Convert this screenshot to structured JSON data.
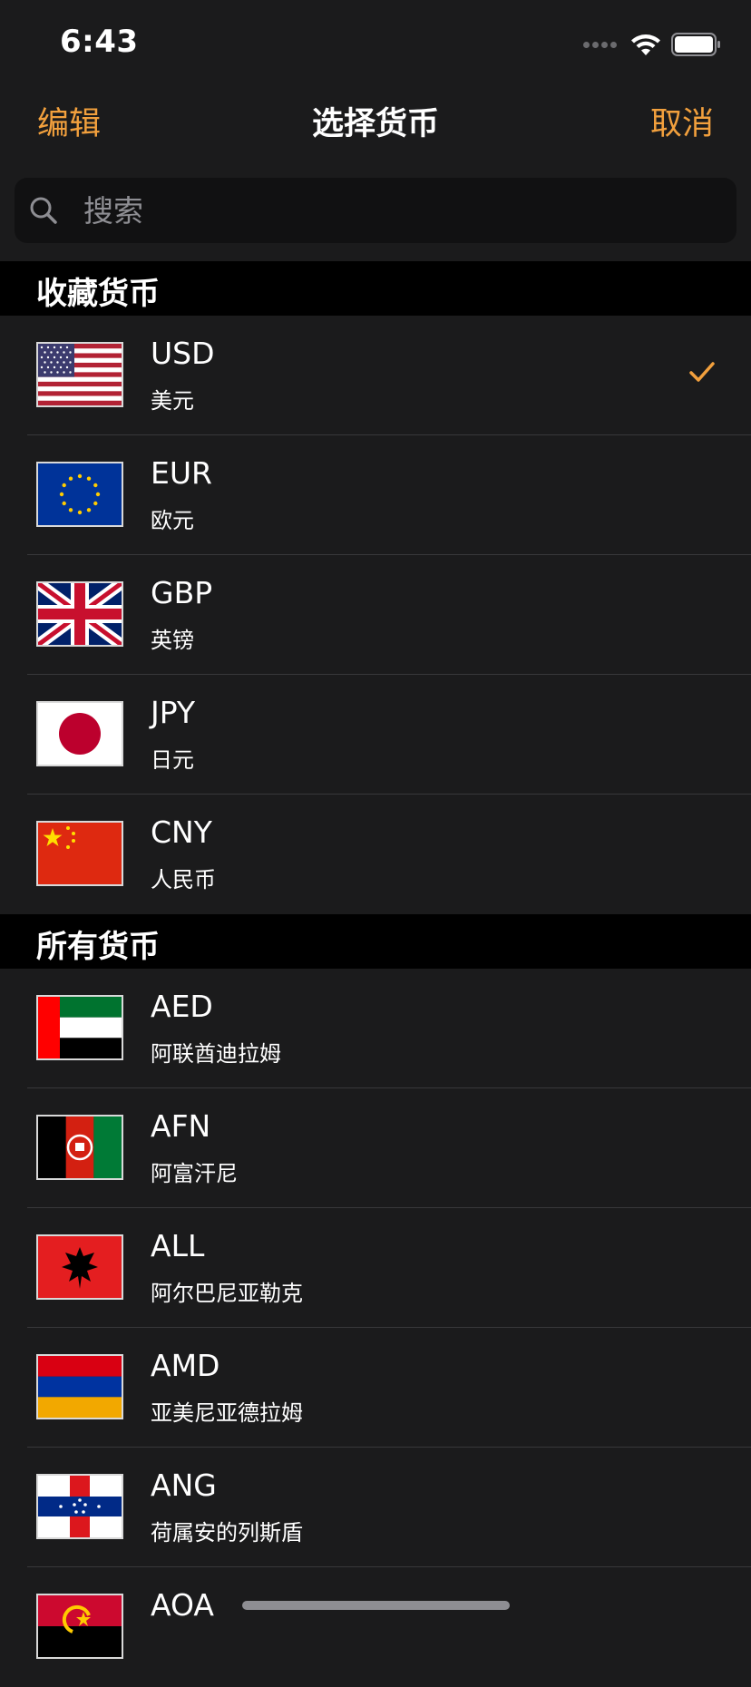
{
  "status_bar": {
    "time": "6:43"
  },
  "nav": {
    "edit_label": "编辑",
    "title": "选择货币",
    "cancel_label": "取消"
  },
  "search": {
    "placeholder": "搜索"
  },
  "sections": [
    {
      "title": "收藏货币",
      "items": [
        {
          "code": "USD",
          "name": "美元",
          "flag": "us-flag",
          "selected": true
        },
        {
          "code": "EUR",
          "name": "欧元",
          "flag": "eu-flag",
          "selected": false
        },
        {
          "code": "GBP",
          "name": "英镑",
          "flag": "gb-flag",
          "selected": false
        },
        {
          "code": "JPY",
          "name": "日元",
          "flag": "jp-flag",
          "selected": false
        },
        {
          "code": "CNY",
          "name": "人民币",
          "flag": "cn-flag",
          "selected": false
        }
      ]
    },
    {
      "title": "所有货币",
      "items": [
        {
          "code": "AED",
          "name": "阿联酋迪拉姆",
          "flag": "ae-flag"
        },
        {
          "code": "AFN",
          "name": "阿富汗尼",
          "flag": "af-flag"
        },
        {
          "code": "ALL",
          "name": "阿尔巴尼亚勒克",
          "flag": "al-flag"
        },
        {
          "code": "AMD",
          "name": "亚美尼亚德拉姆",
          "flag": "am-flag"
        },
        {
          "code": "ANG",
          "name": "荷属安的列斯盾",
          "flag": "an-flag"
        },
        {
          "code": "AOA",
          "name": "",
          "flag": "ao-flag"
        }
      ]
    }
  ],
  "colors": {
    "accent": "#f2a03d",
    "background": "#1b1b1c",
    "section_header": "#000000"
  }
}
